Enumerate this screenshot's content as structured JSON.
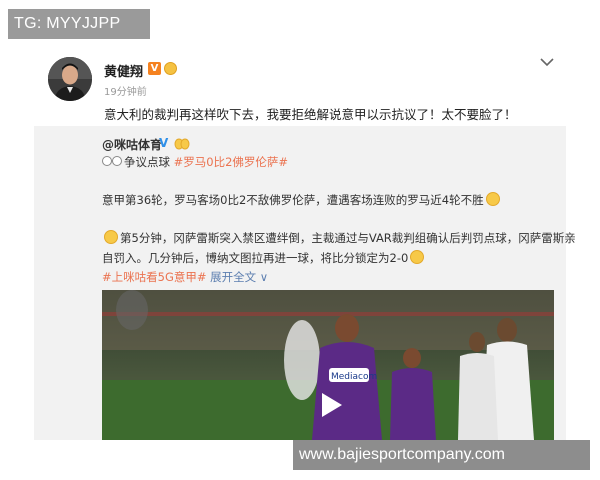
{
  "watermark_top": "TG: MYYJJPP",
  "watermark_bottom": "www.bajiesportcompany.com",
  "post": {
    "author": "黄健翔",
    "badge_icon": "verified-v-icon",
    "medal_icon": "medal-icon",
    "time": "19分钟前",
    "text": "意大利的裁判再这样吹下去，我要拒绝解说意甲以示抗议了！太不要脸了！",
    "more_icon": "chevron-down-icon"
  },
  "repost": {
    "author": "@咪咕体育",
    "verified_mark": "V",
    "line1_prefix": "争议点球 ",
    "line1_tag": "#罗马0比2佛罗伦萨#",
    "line2": "意甲第36轮，罗马客场0比2不敌佛罗伦萨，遭遇客场连败的罗马近4轮不胜",
    "line3": "第5分钟，冈萨雷斯突入禁区遭绊倒，主裁通过与VAR裁判组确认后判罚点球，冈萨雷斯亲",
    "line4": "自罚入。几分钟后，博纳文图拉再进一球，将比分锁定为2-0",
    "line5_link": "#上咪咕看5G意甲#",
    "line5_expand": "展开全文 ∨",
    "video_play_icon": "play-icon",
    "jersey_sponsor": "Mediacom"
  },
  "colors": {
    "tag": "#eb7350",
    "expand": "#5d7fb0",
    "verified_orange": "#f58220",
    "fiorentina_purple": "#5b2a86"
  }
}
